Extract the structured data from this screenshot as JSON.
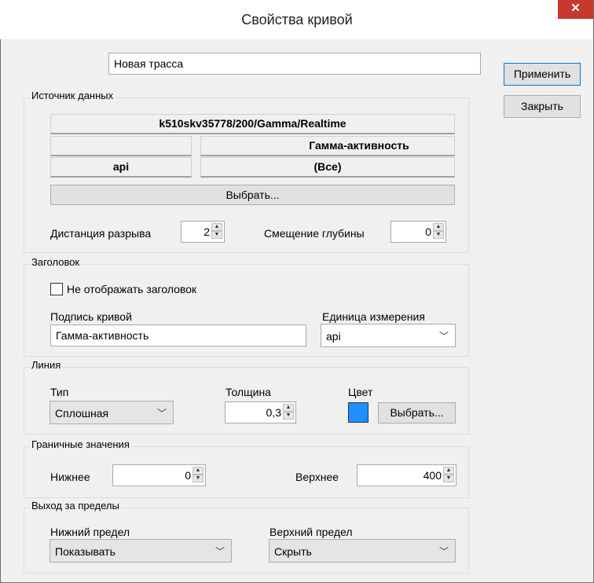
{
  "window": {
    "title": "Свойства кривой"
  },
  "curve_name": "Новая трасса",
  "buttons": {
    "apply": "Применить",
    "close": "Закрыть",
    "select_source": "Выбрать...",
    "select_color": "Выбрать..."
  },
  "source": {
    "group_label": "Источник данных",
    "path": "k510skv35778/200/Gamma/Realtime",
    "empty_field": "",
    "parameter": "Гамма-активность",
    "unit": "api",
    "filter": "(Все)",
    "gap_label": "Дистанция разрыва",
    "gap_value": "2",
    "depth_offset_label": "Смещение глубины",
    "depth_offset_value": "0"
  },
  "header": {
    "group_label": "Заголовок",
    "hide_label": "Не отображать заголовок",
    "hide_checked": false,
    "caption_label": "Подпись кривой",
    "caption_value": "Гамма-активность",
    "unit_label": "Единица измерения",
    "unit_value": "api"
  },
  "line": {
    "group_label": "Линия",
    "type_label": "Тип",
    "type_value": "Сплошная",
    "width_label": "Толщина",
    "width_value": "0,3",
    "color_label": "Цвет",
    "color_hex": "#1e90ff"
  },
  "bounds": {
    "group_label": "Граничные значения",
    "lower_label": "Нижнее",
    "lower_value": "0",
    "upper_label": "Верхнее",
    "upper_value": "400"
  },
  "overflow": {
    "group_label": "Выход за пределы",
    "lower_limit_label": "Нижний предел",
    "lower_limit_value": "Показывать",
    "upper_limit_label": "Верхний предел",
    "upper_limit_value": "Скрыть"
  }
}
